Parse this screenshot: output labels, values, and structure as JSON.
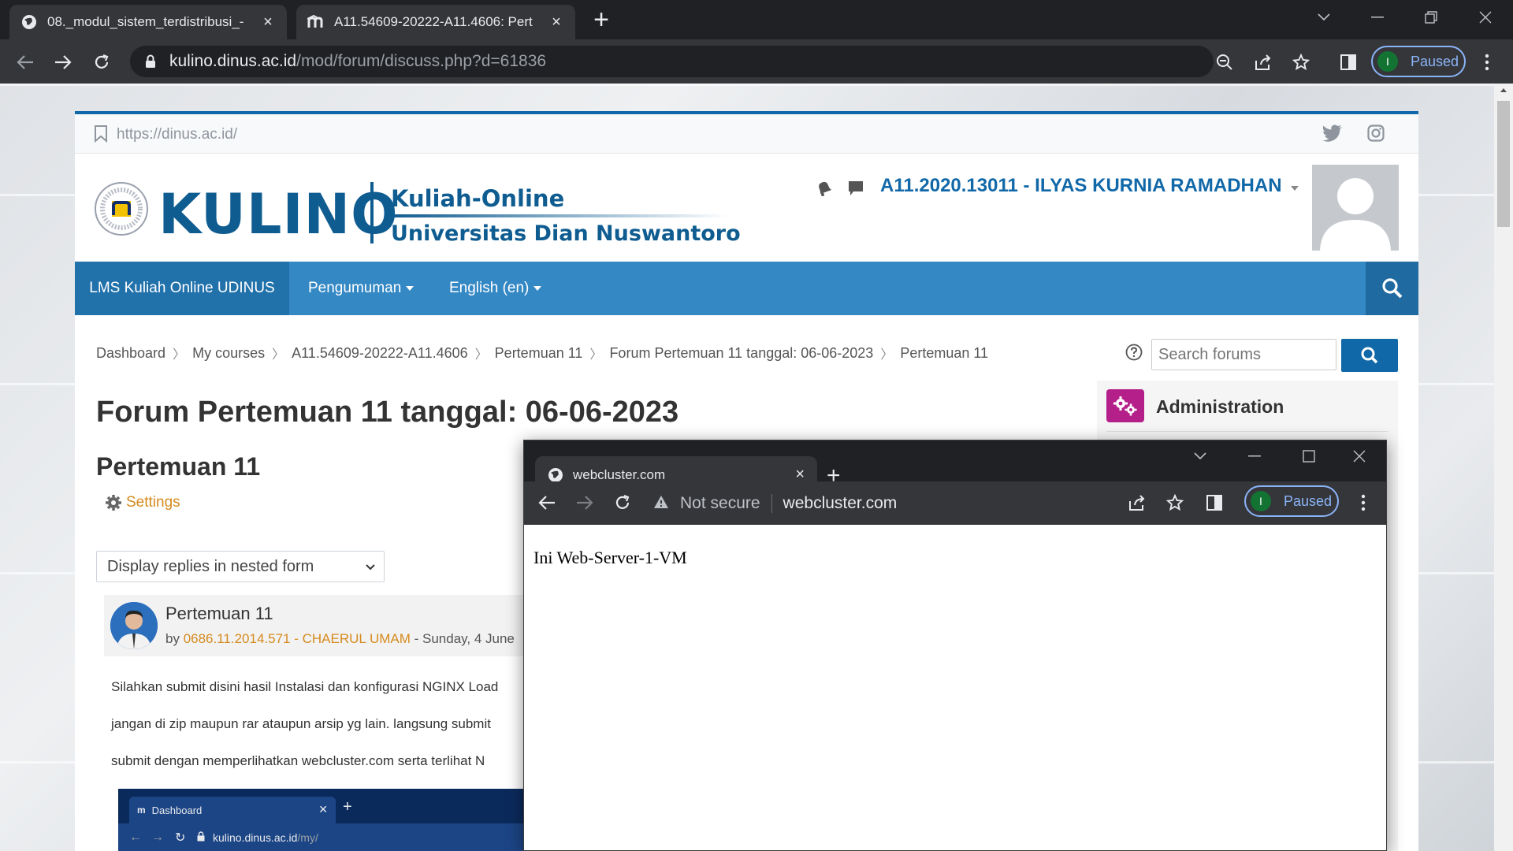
{
  "browser": {
    "tabs": [
      {
        "title": "08._modul_sistem_terdistribusi_-",
        "favicon": "globe-icon",
        "active": false
      },
      {
        "title": "A11.54609-20222-A11.4606: Pert",
        "favicon": "moodle-icon",
        "active": true
      }
    ],
    "address": {
      "host": "kulino.dinus.ac.id",
      "path": "/mod/forum/discuss.php?d=61836"
    },
    "profile": {
      "initial": "I",
      "status": "Paused"
    }
  },
  "site": {
    "top_url": "https://dinus.ac.id/",
    "brand": "KULINO",
    "brand_line1": "Kuliah-Online",
    "brand_line2": "Universitas Dian Nuswantoro",
    "user_name": "A11.2020.13011 - ILYAS KURNIA RAMADHAN",
    "nav": {
      "home": "LMS Kuliah Online UDINUS",
      "items": [
        "Pengumuman",
        "English (en)"
      ]
    },
    "breadcrumb": [
      "Dashboard",
      "My courses",
      "A11.54609-20222-A11.4606",
      "Pertemuan 11",
      "Forum Pertemuan 11 tanggal: 06-06-2023",
      "Pertemuan 11"
    ],
    "search_placeholder": "Search forums",
    "forum_title": "Forum Pertemuan 11 tanggal: 06-06-2023",
    "discussion_title": "Pertemuan 11",
    "settings_label": "Settings",
    "display_mode": "Display replies in nested form",
    "admin_title": "Administration",
    "post": {
      "title": "Pertemuan 11",
      "by_prefix": "by ",
      "author": "0686.11.2014.571 - CHAERUL UMAM",
      "date": " - Sunday, 4 June",
      "lines": [
        "Silahkan submit disini hasil Instalasi dan konfigurasi NGINX Load",
        "jangan di zip maupun rar ataupun arsip yg lain. langsung submit",
        "submit dengan memperlihatkan webcluster.com  serta terlihat N"
      ]
    },
    "embedded_shot": {
      "tab_title": "Dashboard",
      "url_host": "kulino.dinus.ac.id",
      "url_path": "/my/"
    }
  },
  "popup": {
    "tab_title": "webcluster.com",
    "not_secure": "Not secure",
    "host": "webcluster.com",
    "profile_initial": "I",
    "profile_status": "Paused",
    "content": "Ini Web-Server-1-VM"
  },
  "colors": {
    "accent_blue": "#1168a8",
    "nav_blue": "#3488c4",
    "link_orange": "#d58b1e",
    "admin_magenta": "#b51f8a"
  }
}
